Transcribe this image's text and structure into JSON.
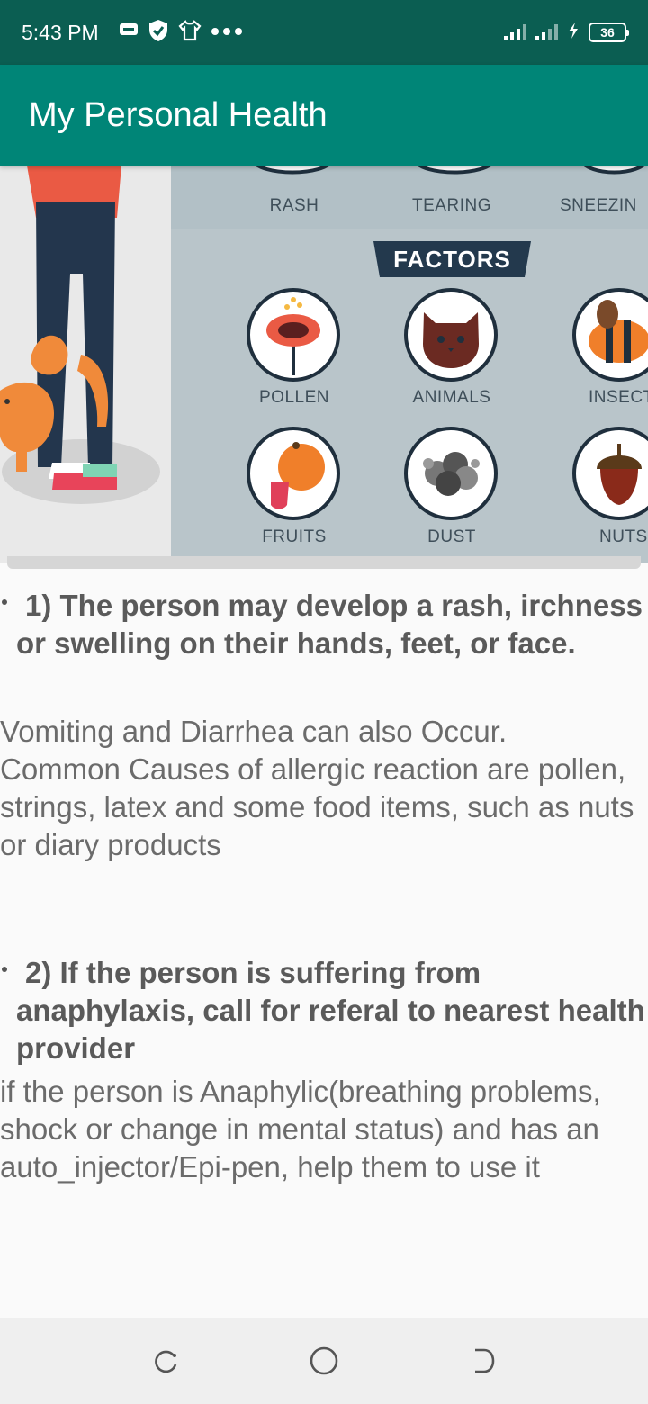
{
  "status_bar": {
    "time": "5:43 PM",
    "battery": "36",
    "icons": [
      "message-icon",
      "shield-icon",
      "shirt-icon",
      "more-dots-icon",
      "signal-icon",
      "signal-icon",
      "charging-icon",
      "battery-icon"
    ]
  },
  "app_bar": {
    "title": "My Personal Health"
  },
  "illustration": {
    "symptom_labels": [
      "RASH",
      "TEARING",
      "SNEEZIN"
    ],
    "banner": "FACTORS",
    "factor_labels": [
      "POLLEN",
      "ANIMALS",
      "INSECTS",
      "FRUITS",
      "DUST",
      "NUTS"
    ]
  },
  "content": {
    "point1_heading": "1) The person may develop a rash, irchness or swelling on their hands, feet, or face.",
    "point1_body": "Vomiting and Diarrhea can also Occur.\n Common Causes of allergic reaction are pollen, strings, latex and some food items, such as nuts or diary products",
    "point2_heading": "2) If the person is suffering from anaphylaxis, call for referal to nearest health provider",
    "point2_body": "if the person is Anaphylic(breathing problems, shock or change in mental status) and has an auto_injector/Epi-pen, help them to use it"
  },
  "nav_bar": {
    "icons": [
      "recent-apps-icon",
      "home-icon",
      "back-icon"
    ]
  },
  "colors": {
    "status_bar": "#0b5e52",
    "app_bar": "#008577",
    "banner": "#23394d"
  }
}
